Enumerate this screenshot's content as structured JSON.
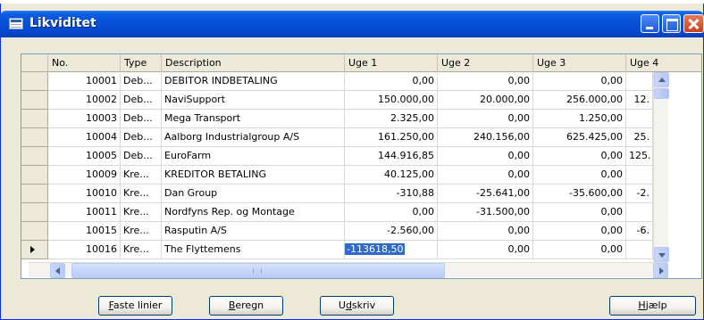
{
  "window": {
    "title": "Likviditet"
  },
  "columns": {
    "no": "No.",
    "type": "Type",
    "description": "Description",
    "uge1": "Uge 1",
    "uge2": "Uge 2",
    "uge3": "Uge 3",
    "uge4": "Uge 4"
  },
  "rows": [
    {
      "no": "10001",
      "type": "Deb...",
      "description": "DEBITOR INDBETALING",
      "uge1": "0,00",
      "uge2": "0,00",
      "uge3": "0,00",
      "uge4": ""
    },
    {
      "no": "10002",
      "type": "Deb...",
      "description": "NaviSupport",
      "uge1": "150.000,00",
      "uge2": "20.000,00",
      "uge3": "256.000,00",
      "uge4": "12."
    },
    {
      "no": "10003",
      "type": "Deb...",
      "description": "Mega Transport",
      "uge1": "2.325,00",
      "uge2": "0,00",
      "uge3": "1.250,00",
      "uge4": ""
    },
    {
      "no": "10004",
      "type": "Deb...",
      "description": "Aalborg Industrialgroup A/S",
      "uge1": "161.250,00",
      "uge2": "240.156,00",
      "uge3": "625.425,00",
      "uge4": "25."
    },
    {
      "no": "10005",
      "type": "Deb...",
      "description": "EuroFarm",
      "uge1": "144.916,85",
      "uge2": "0,00",
      "uge3": "0,00",
      "uge4": "125."
    },
    {
      "no": "10009",
      "type": "Kre...",
      "description": "KREDITOR BETALING",
      "uge1": "40.125,00",
      "uge2": "0,00",
      "uge3": "0,00",
      "uge4": ""
    },
    {
      "no": "10010",
      "type": "Kre...",
      "description": "Dan Group",
      "uge1": "-310,88",
      "uge2": "-25.641,00",
      "uge3": "-35.600,00",
      "uge4": "-2."
    },
    {
      "no": "10011",
      "type": "Kre...",
      "description": "Nordfyns Rep. og Montage",
      "uge1": "0,00",
      "uge2": "-31.500,00",
      "uge3": "0,00",
      "uge4": ""
    },
    {
      "no": "10015",
      "type": "Kre...",
      "description": "Rasputin A/S",
      "uge1": "-2.560,00",
      "uge2": "0,00",
      "uge3": "0,00",
      "uge4": "-6."
    },
    {
      "no": "10016",
      "type": "Kre...",
      "description": "The Flyttemens",
      "uge1": "-113618,50",
      "uge2": "0,00",
      "uge3": "0,00",
      "uge4": ""
    }
  ],
  "buttons": {
    "faste_linier": {
      "prefix": "",
      "accel": "F",
      "rest": "aste linier"
    },
    "beregn": {
      "prefix": "",
      "accel": "B",
      "rest": "eregn"
    },
    "udskriv": {
      "prefix": "U",
      "accel": "d",
      "rest": "skriv"
    },
    "hjaelp": {
      "prefix": "",
      "accel": "H",
      "rest": "jælp"
    }
  },
  "icons": {
    "window_icon": "table-icon",
    "current_row_marker": "triangle-right-icon"
  }
}
